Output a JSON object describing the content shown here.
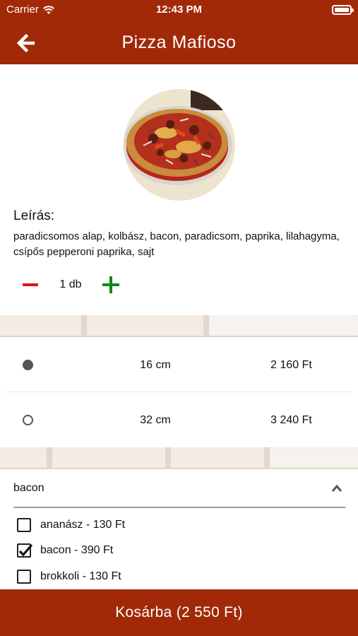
{
  "status_bar": {
    "carrier": "Carrier",
    "time": "12:43 PM"
  },
  "header": {
    "title": "Pizza Mafioso",
    "back_icon": "arrow-left-icon"
  },
  "product": {
    "description_label": "Leírás:",
    "description": "paradicsomos alap, kolbász, bacon, paradicsom, paprika, lilahagyma, csípős pepperoni paprika, sajt",
    "quantity": "1 db"
  },
  "sizes": [
    {
      "size": "16 cm",
      "price": "2 160 Ft",
      "selected": true
    },
    {
      "size": "32 cm",
      "price": "3 240 Ft",
      "selected": false
    }
  ],
  "extras": {
    "selected_value": "bacon",
    "options": [
      {
        "label": "ananász - 130 Ft",
        "checked": false
      },
      {
        "label": "bacon - 390 Ft",
        "checked": true
      },
      {
        "label": "brokkoli - 130 Ft",
        "checked": false
      }
    ]
  },
  "cart_button": "Kosárba (2 550 Ft)",
  "colors": {
    "brand": "#a12908",
    "minus": "#e11414",
    "plus": "#0e8a11"
  }
}
